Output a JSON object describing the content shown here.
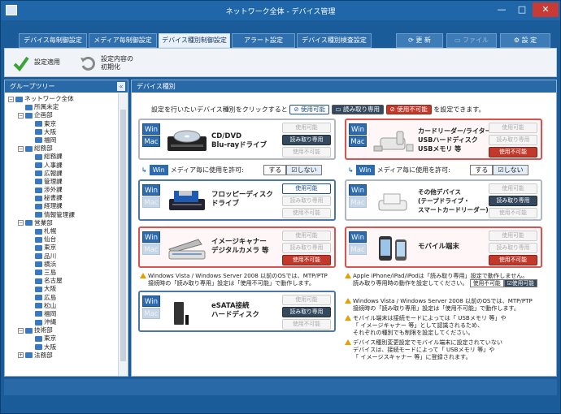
{
  "window": {
    "title": "ネットワーク全体 - デバイス管理",
    "min": "—",
    "max": "□",
    "close": "✕"
  },
  "tabs": [
    {
      "label": "デバイス毎制御設定"
    },
    {
      "label": "メディア毎制御設定"
    },
    {
      "label": "デバイス種別制御設定"
    },
    {
      "label": "アラート設定"
    },
    {
      "label": "デバイス種別検査設定"
    }
  ],
  "right_tabs": {
    "refresh": "更 新",
    "file": "ファイル",
    "settings": "設 定"
  },
  "ribbon": {
    "apply": "設定適用",
    "reset_line1": "設定内容の",
    "reset_line2": "初期化"
  },
  "left_pane": {
    "title": "グループツリー",
    "collapse": "«",
    "tree": [
      {
        "label": "ネットワーク全体",
        "level": 0,
        "exp": "−"
      },
      {
        "label": "所属未定",
        "level": 1,
        "exp": ""
      },
      {
        "label": "企画部",
        "level": 1,
        "exp": "−"
      },
      {
        "label": "東京",
        "level": 2,
        "exp": ""
      },
      {
        "label": "大阪",
        "level": 2,
        "exp": ""
      },
      {
        "label": "福岡",
        "level": 2,
        "exp": ""
      },
      {
        "label": "総務部",
        "level": 1,
        "exp": "−"
      },
      {
        "label": "総務課",
        "level": 2,
        "exp": ""
      },
      {
        "label": "人事課",
        "level": 2,
        "exp": ""
      },
      {
        "label": "広報課",
        "level": 2,
        "exp": ""
      },
      {
        "label": "管理課",
        "level": 2,
        "exp": ""
      },
      {
        "label": "渉外課",
        "level": 2,
        "exp": ""
      },
      {
        "label": "秘書課",
        "level": 2,
        "exp": ""
      },
      {
        "label": "経理課",
        "level": 2,
        "exp": ""
      },
      {
        "label": "情報管理課",
        "level": 2,
        "exp": ""
      },
      {
        "label": "営業部",
        "level": 1,
        "exp": "−"
      },
      {
        "label": "札幌",
        "level": 2,
        "exp": ""
      },
      {
        "label": "仙台",
        "level": 2,
        "exp": ""
      },
      {
        "label": "東京",
        "level": 2,
        "exp": ""
      },
      {
        "label": "品川",
        "level": 2,
        "exp": ""
      },
      {
        "label": "横浜",
        "level": 2,
        "exp": ""
      },
      {
        "label": "三島",
        "level": 2,
        "exp": ""
      },
      {
        "label": "名古屋",
        "level": 2,
        "exp": ""
      },
      {
        "label": "大阪",
        "level": 2,
        "exp": ""
      },
      {
        "label": "広島",
        "level": 2,
        "exp": ""
      },
      {
        "label": "松山",
        "level": 2,
        "exp": ""
      },
      {
        "label": "福岡",
        "level": 2,
        "exp": ""
      },
      {
        "label": "沖縄",
        "level": 2,
        "exp": ""
      },
      {
        "label": "技術部",
        "level": 1,
        "exp": "−"
      },
      {
        "label": "東京",
        "level": 2,
        "exp": ""
      },
      {
        "label": "大阪",
        "level": 2,
        "exp": ""
      },
      {
        "label": "法務部",
        "level": 1,
        "exp": "+"
      }
    ]
  },
  "right_pane": {
    "title": "デバイス種別",
    "intro_pre": "設定を行いたいデバイス種別をクリックすると",
    "intro_post": "を設定できます。",
    "pill_ok": "使用可能",
    "pill_ro": "読み取り専用",
    "pill_ng": "使用不可能"
  },
  "labels": {
    "win": "Win",
    "mac": "Mac",
    "ok": "使用可能",
    "ro": "読み取り専用",
    "ng": "使用不可能",
    "permit": "メディア毎に使用を許可:",
    "permit_yes": "する",
    "permit_no": "☑しない"
  },
  "devices": {
    "cd": {
      "name1": "CD/DVD",
      "name2": "Blu-rayドライブ"
    },
    "card": {
      "name1": "カードリーダー/ライター",
      "name2": "USBハードディスク",
      "name3": "USBメモリ 等"
    },
    "floppy": {
      "name1": "フロッピーディスク",
      "name2": "ドライブ"
    },
    "other": {
      "name1": "その他デバイス",
      "name2": "(テープドライブ・",
      "name3": "スマートカードリーダー)"
    },
    "scanner": {
      "name1": "イメージキャナー",
      "name2": "デジタルカメラ 等"
    },
    "mobile": {
      "name1": "モバイル端末"
    },
    "esata": {
      "name1": "eSATA接続",
      "name2": "ハードディスク"
    }
  },
  "notes": {
    "left1": "Windows Vista / Windows Server 2008 以前のOSでは、MTP/PTP",
    "left2": "接続時の「読み取り専用」設定は「使用不可能」で動作します。",
    "apple1": "Apple iPhone/iPad/iPodは「読み取り専用」設定で動作しません。",
    "apple2": "読み取り専用時の動作を設定してください。",
    "apple_ng": "使用不可能",
    "apple_ok": "☑使用可能",
    "r1a": "Windows Vista / Windows Server 2008 以前のOSでは、MTP/PTP",
    "r1b": "接続時の「読み取り専用」設定は「使用不可能」で動作します。",
    "r2a": "モバイル端末は接続モードによっては「 USBメモリ 等」や",
    "r2b": "「 イメージキャナー 等」として認識されるため、",
    "r2c": "それぞれの種別でも制限を設定してください。",
    "r3a": "デバイス種別変更設定でモバイル端末に設定されていない",
    "r3b": "デバイスは、接続モードによって「 USBメモリ 等」や",
    "r3c": "「 イメージスキャナー 等」に登録されます。"
  }
}
